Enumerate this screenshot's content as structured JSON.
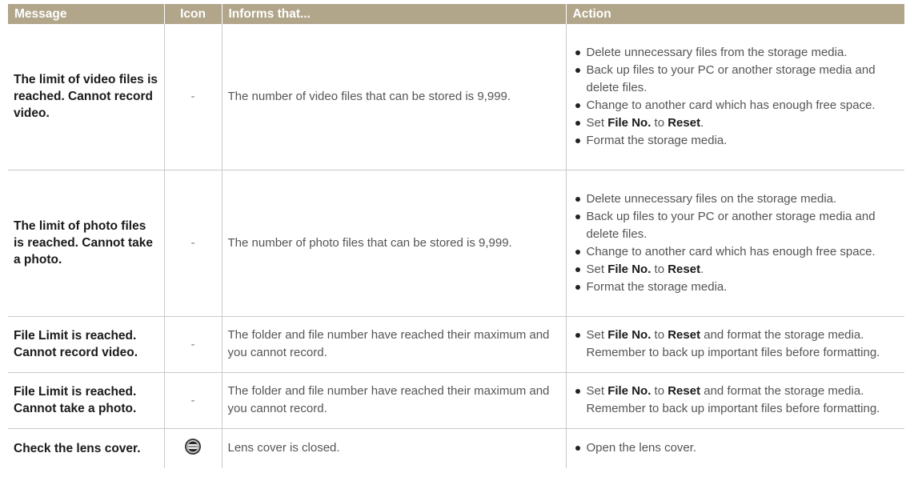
{
  "header": {
    "message": "Message",
    "icon": "Icon",
    "informs": "Informs that...",
    "action": "Action"
  },
  "rows": [
    {
      "message": "The limit of video files is reached. Cannot record video.",
      "icon": "-",
      "informs": "The number of video files that can be stored is 9,999.",
      "actions": [
        {
          "text": "Delete unnecessary files from the storage media."
        },
        {
          "text": "Back up files to your PC or another storage media and delete files."
        },
        {
          "text": "Change to another card which has enough free space."
        },
        {
          "pre": "Set ",
          "b1": "File No.",
          "mid": " to ",
          "b2": "Reset",
          "post": "."
        },
        {
          "text": "Format the storage media."
        }
      ]
    },
    {
      "message": "The limit of photo files is reached. Cannot take a photo.",
      "icon": "-",
      "informs": "The number of photo files that can be stored is 9,999.",
      "actions": [
        {
          "text": "Delete unnecessary files on the storage media."
        },
        {
          "text": "Back up files to your PC or another storage media and delete files."
        },
        {
          "text": "Change to another card which has enough free space."
        },
        {
          "pre": "Set ",
          "b1": "File No.",
          "mid": " to ",
          "b2": "Reset",
          "post": "."
        },
        {
          "text": "Format the storage media."
        }
      ]
    },
    {
      "message": "File Limit is reached. Cannot record video.",
      "icon": "-",
      "informs": "The folder and file number have reached their maximum and you cannot record.",
      "actions": [
        {
          "pre": "Set ",
          "b1": "File No.",
          "mid": " to ",
          "b2": "Reset",
          "post": " and format the storage media. Remember to back up important files before formatting."
        }
      ]
    },
    {
      "message": "File Limit is reached. Cannot take a photo.",
      "icon": "-",
      "informs": "The folder and file number have reached their maximum and you cannot record.",
      "actions": [
        {
          "pre": "Set ",
          "b1": "File No.",
          "mid": " to ",
          "b2": "Reset",
          "post": " and format the storage media. Remember to back up important files before formatting."
        }
      ]
    },
    {
      "message": "Check the lens cover.",
      "icon": "lens-cover-icon",
      "informs": "Lens cover is closed.",
      "actions": [
        {
          "text": "Open the lens cover."
        }
      ]
    }
  ]
}
